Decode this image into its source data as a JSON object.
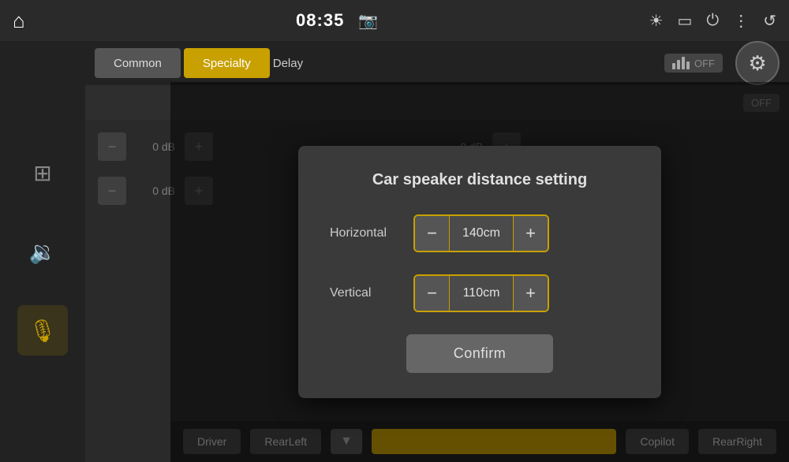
{
  "statusBar": {
    "time": "08:35",
    "icons": [
      "camera",
      "brightness",
      "battery",
      "power",
      "menu",
      "back"
    ]
  },
  "sidebar": {
    "items": [
      {
        "id": "equalizer",
        "icon": "⊞",
        "active": false
      },
      {
        "id": "volume",
        "icon": "🔊",
        "active": false
      },
      {
        "id": "audio",
        "icon": "🎙",
        "active": true
      }
    ]
  },
  "tabs": {
    "common_label": "Common",
    "specialty_label": "Specialty",
    "delay_label": "Delay",
    "toggle1": "OFF",
    "toggle2": "OFF"
  },
  "dialog": {
    "title": "Car speaker distance setting",
    "horizontal_label": "Horizontal",
    "horizontal_value": "140cm",
    "vertical_label": "Vertical",
    "vertical_value": "110cm",
    "confirm_label": "Confirm"
  },
  "background": {
    "row1_db": "0 dB",
    "row2_db": "0 dB",
    "driver_label": "Driver",
    "copilot_label": "Copilot",
    "rearleft_label": "RearLeft",
    "rearright_label": "RearRight"
  }
}
